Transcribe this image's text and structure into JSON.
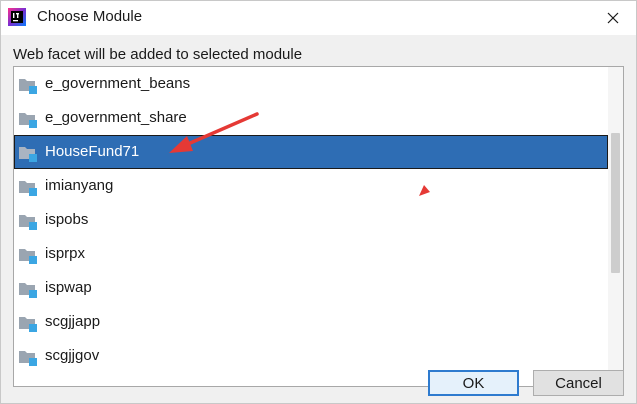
{
  "window": {
    "title": "Choose Module",
    "close_label": "×",
    "accent_color": "#2e6db4",
    "annotation_color": "#e53935"
  },
  "dialog": {
    "prompt": "Web facet will be added to selected module"
  },
  "modules": [
    {
      "label": "e_government_beans",
      "icon": "module-folder-icon",
      "selected": false
    },
    {
      "label": "e_government_share",
      "icon": "module-folder-icon",
      "selected": false
    },
    {
      "label": "HouseFund71",
      "icon": "module-folder-icon",
      "selected": true
    },
    {
      "label": "imianyang",
      "icon": "module-folder-icon",
      "selected": false
    },
    {
      "label": "ispobs",
      "icon": "module-folder-icon",
      "selected": false
    },
    {
      "label": "isprpx",
      "icon": "module-folder-icon",
      "selected": false
    },
    {
      "label": "ispwap",
      "icon": "module-folder-icon",
      "selected": false
    },
    {
      "label": "scgjjapp",
      "icon": "module-folder-icon",
      "selected": false
    },
    {
      "label": "scgjjgov",
      "icon": "module-folder-icon",
      "selected": false
    }
  ],
  "buttons": {
    "ok": "OK",
    "cancel": "Cancel"
  }
}
